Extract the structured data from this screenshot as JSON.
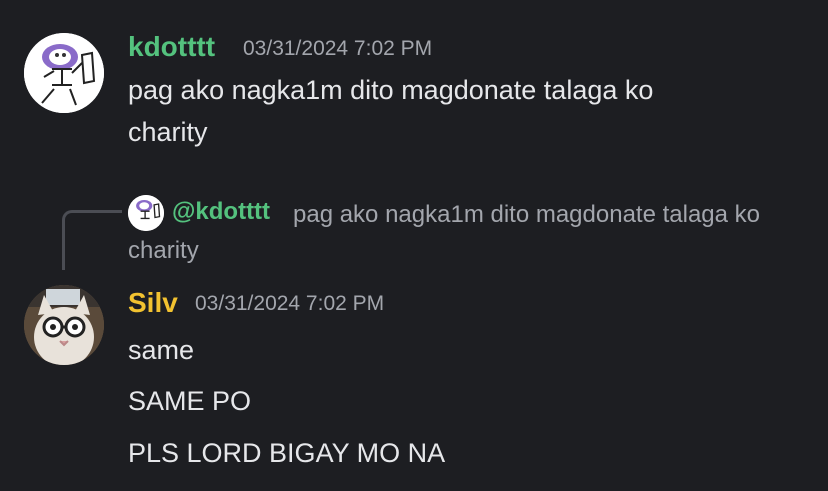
{
  "colors": {
    "background": "#1d1e22",
    "user1_name": "#54c27e",
    "user2_name": "#f2c230",
    "text": "#e6e7ea",
    "muted": "#a3a6ad"
  },
  "messages": [
    {
      "username": "kdotttt",
      "timestamp": "03/31/2024 7:02 PM",
      "avatar_icon": "sketch-character-avatar",
      "lines": [
        "pag ako nagka1m dito magdonate talaga ko charity"
      ]
    },
    {
      "username": "Silv",
      "timestamp": "03/31/2024 7:02 PM",
      "avatar_icon": "cat-with-glasses-avatar",
      "reply": {
        "mention": "@kdotttt",
        "preview": "pag ako nagka1m dito magdonate talaga ko charity"
      },
      "lines": [
        "same",
        "SAME PO",
        "PLS LORD BIGAY MO NA"
      ]
    }
  ]
}
